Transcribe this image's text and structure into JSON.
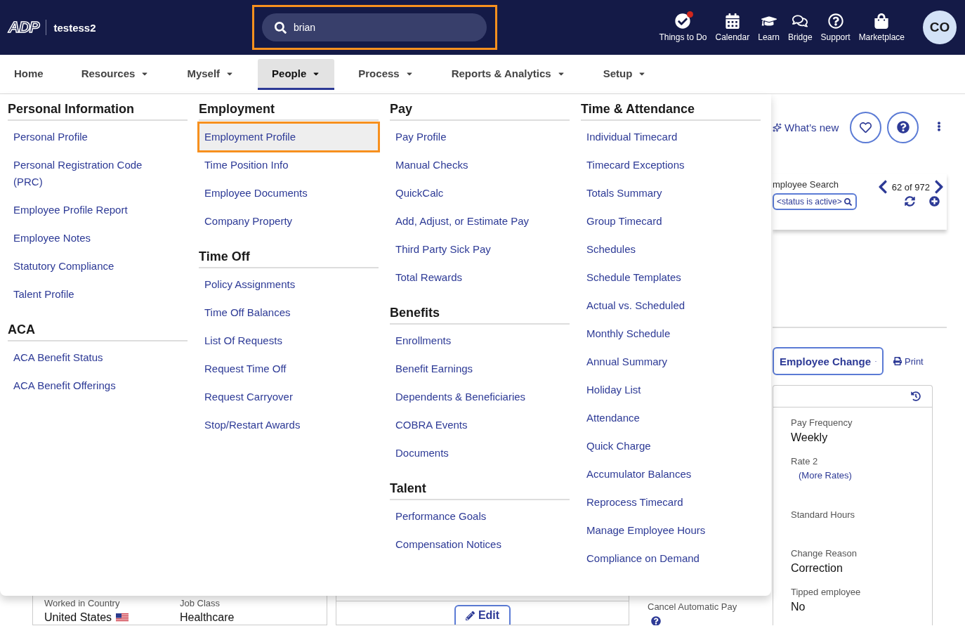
{
  "header": {
    "logo": "ADP",
    "company": "testess2",
    "search": {
      "value": "brian",
      "highlighted": true
    },
    "tools": [
      {
        "label": "Things to Do",
        "badge": true
      },
      {
        "label": "Calendar",
        "badge": false
      },
      {
        "label": "Learn",
        "badge": false
      },
      {
        "label": "Bridge",
        "badge": false
      },
      {
        "label": "Support",
        "badge": false
      },
      {
        "label": "Marketplace",
        "badge": false
      }
    ],
    "avatar": "CO"
  },
  "nav": [
    {
      "label": "Home",
      "dropdown": false,
      "selected": false
    },
    {
      "label": "Resources",
      "dropdown": true,
      "selected": false
    },
    {
      "label": "Myself",
      "dropdown": true,
      "selected": false
    },
    {
      "label": "People",
      "dropdown": true,
      "selected": true
    },
    {
      "label": "Process",
      "dropdown": true,
      "selected": false
    },
    {
      "label": "Reports & Analytics",
      "dropdown": true,
      "selected": false
    },
    {
      "label": "Setup",
      "dropdown": true,
      "selected": false
    }
  ],
  "menu": [
    [
      {
        "title": "Personal Information",
        "items": [
          {
            "label": "Personal Profile",
            "selected": false
          },
          {
            "label": "Personal Registration Code (PRC)",
            "selected": false
          },
          {
            "label": "Employee Profile Report",
            "selected": false
          },
          {
            "label": "Employee Notes",
            "selected": false
          },
          {
            "label": "Statutory Compliance",
            "selected": false
          },
          {
            "label": "Talent Profile",
            "selected": false
          }
        ]
      },
      {
        "title": "ACA",
        "items": [
          {
            "label": "ACA Benefit Status",
            "selected": false
          },
          {
            "label": "ACA Benefit Offerings",
            "selected": false
          }
        ]
      }
    ],
    [
      {
        "title": "Employment",
        "items": [
          {
            "label": "Employment Profile",
            "selected": true
          },
          {
            "label": "Time Position Info",
            "selected": false
          },
          {
            "label": "Employee Documents",
            "selected": false
          },
          {
            "label": "Company Property",
            "selected": false
          }
        ]
      },
      {
        "title": "Time Off",
        "items": [
          {
            "label": "Policy Assignments",
            "selected": false
          },
          {
            "label": "Time Off Balances",
            "selected": false
          },
          {
            "label": "List Of Requests",
            "selected": false
          },
          {
            "label": "Request Time Off",
            "selected": false
          },
          {
            "label": "Request Carryover",
            "selected": false
          },
          {
            "label": "Stop/Restart Awards",
            "selected": false
          }
        ]
      }
    ],
    [
      {
        "title": "Pay",
        "items": [
          {
            "label": "Pay Profile",
            "selected": false
          },
          {
            "label": "Manual Checks",
            "selected": false
          },
          {
            "label": "QuickCalc",
            "selected": false
          },
          {
            "label": "Add, Adjust, or Estimate Pay",
            "selected": false
          },
          {
            "label": "Third Party Sick Pay",
            "selected": false
          },
          {
            "label": "Total Rewards",
            "selected": false
          }
        ]
      },
      {
        "title": "Benefits",
        "items": [
          {
            "label": "Enrollments",
            "selected": false
          },
          {
            "label": "Benefit Earnings",
            "selected": false
          },
          {
            "label": "Dependents & Beneficiaries",
            "selected": false
          },
          {
            "label": "COBRA Events",
            "selected": false
          },
          {
            "label": "Documents",
            "selected": false
          }
        ]
      },
      {
        "title": "Talent",
        "items": [
          {
            "label": "Performance Goals",
            "selected": false
          },
          {
            "label": "Compensation Notices",
            "selected": false
          }
        ]
      }
    ],
    [
      {
        "title": "Time & Attendance",
        "items": [
          {
            "label": "Individual Timecard",
            "selected": false
          },
          {
            "label": "Timecard Exceptions",
            "selected": false
          },
          {
            "label": "Totals Summary",
            "selected": false
          },
          {
            "label": "Group Timecard",
            "selected": false
          },
          {
            "label": "Schedules",
            "selected": false
          },
          {
            "label": "Schedule Templates",
            "selected": false
          },
          {
            "label": "Actual vs. Scheduled",
            "selected": false
          },
          {
            "label": "Monthly Schedule",
            "selected": false
          },
          {
            "label": "Annual Summary",
            "selected": false
          },
          {
            "label": "Holiday List",
            "selected": false
          },
          {
            "label": "Attendance",
            "selected": false
          },
          {
            "label": "Quick Charge",
            "selected": false
          },
          {
            "label": "Accumulator Balances",
            "selected": false
          },
          {
            "label": "Reprocess Timecard",
            "selected": false
          },
          {
            "label": "Manage Employee Hours",
            "selected": false
          },
          {
            "label": "Compliance on Demand",
            "selected": false
          }
        ]
      }
    ]
  ],
  "page": {
    "whats_new": "What’s new",
    "employee_search": {
      "label": "mployee Search",
      "filter": "<status is active>",
      "position": "62 of 972"
    },
    "change_button": "Employee Change",
    "print": "Print",
    "fields": [
      {
        "label": "Pay Frequency",
        "value": "Weekly"
      },
      {
        "label": "Rate 2",
        "link": "(More Rates)"
      },
      {
        "label": "Standard Hours"
      },
      {
        "label": "Change Reason",
        "value": "Correction"
      },
      {
        "label": "Tipped employee",
        "value": "No"
      }
    ],
    "bottom": {
      "country": {
        "label": "Worked in Country",
        "value": "United States"
      },
      "job_class": {
        "label": "Job Class",
        "value": "Healthcare"
      },
      "edit": "Edit",
      "cancel_pay": "Cancel Automatic Pay"
    }
  }
}
